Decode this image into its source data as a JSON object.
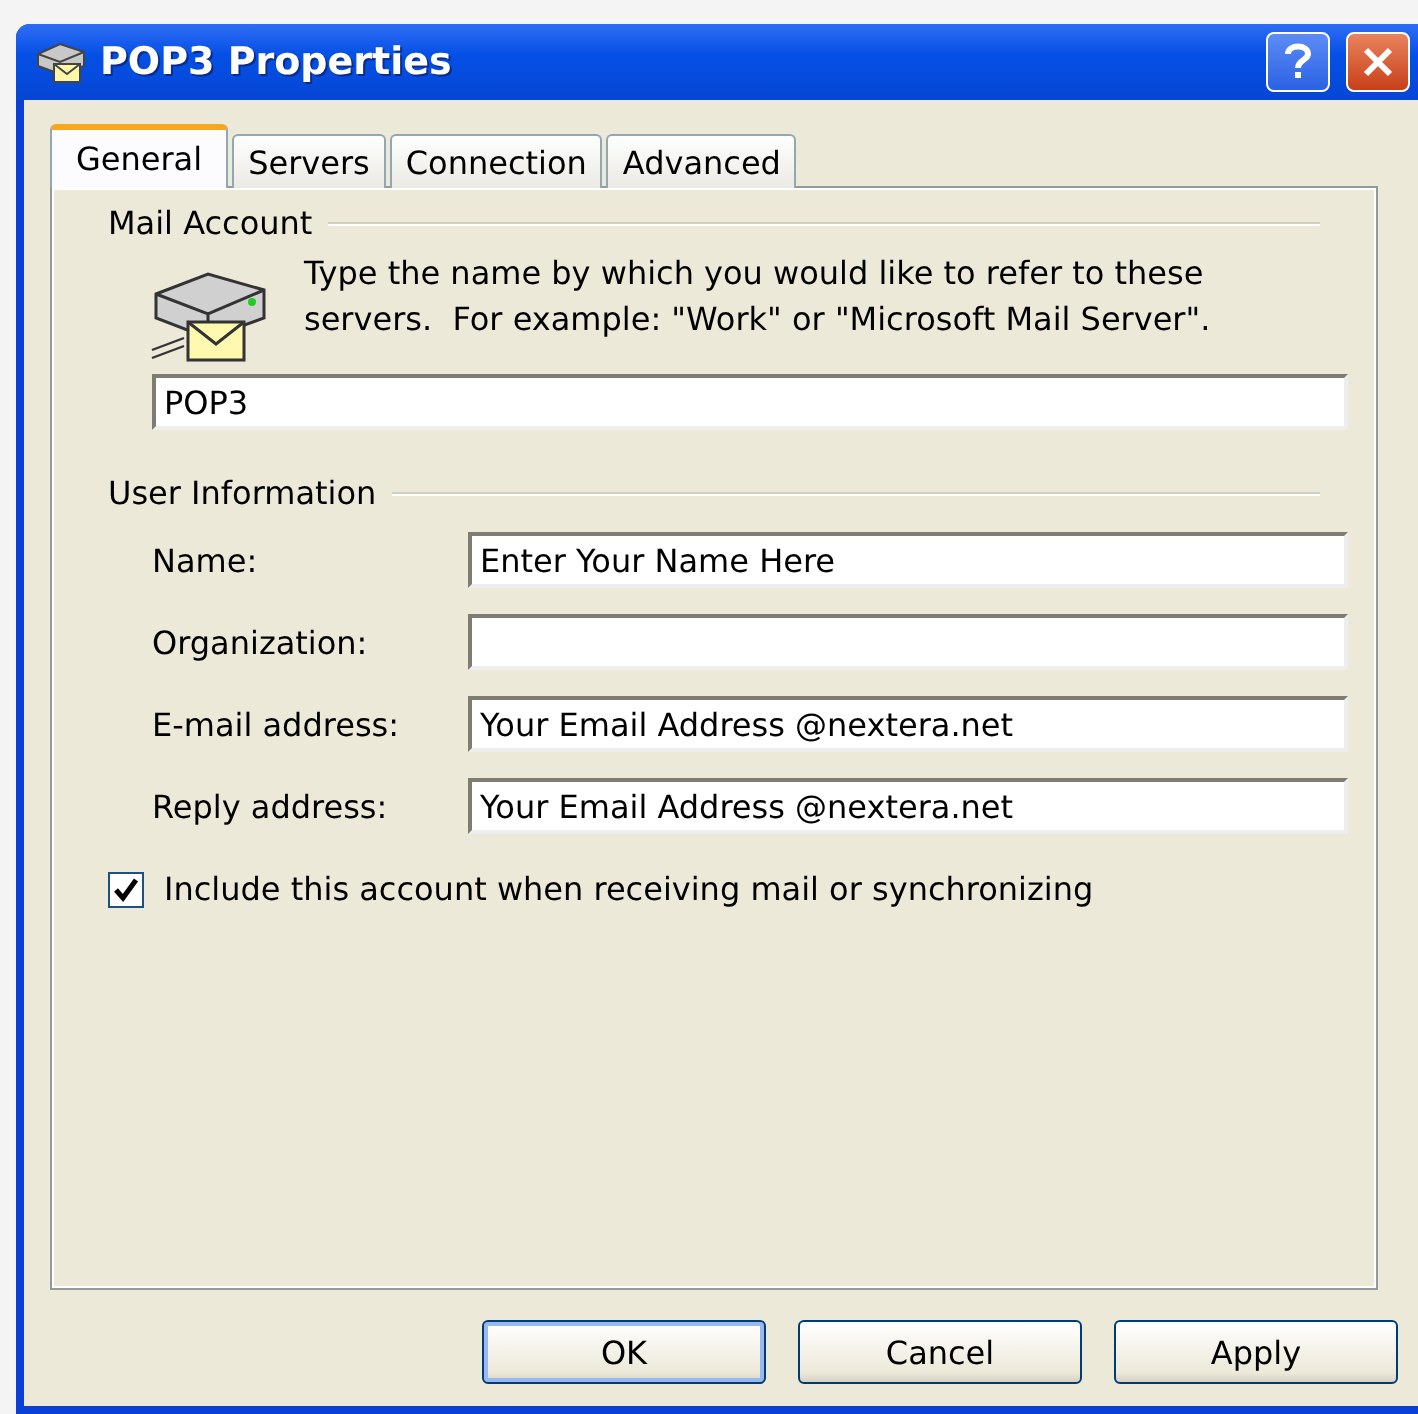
{
  "window": {
    "title": "POP3 Properties"
  },
  "tabs": [
    {
      "label": "General",
      "selected": true
    },
    {
      "label": "Servers",
      "selected": false
    },
    {
      "label": "Connection",
      "selected": false
    },
    {
      "label": "Advanced",
      "selected": false
    }
  ],
  "mail_account": {
    "heading": "Mail Account",
    "description": "Type the name by which you would like to refer to these servers.  For example: \"Work\" or \"Microsoft Mail Server\".",
    "value": "POP3"
  },
  "user_information": {
    "heading": "User Information",
    "fields": [
      {
        "label": "Name:",
        "value": "Enter Your Name Here"
      },
      {
        "label": "Organization:"
      },
      {
        "label": "E-mail address:",
        "value": "Your Email Address @nextera.net"
      },
      {
        "label": "Reply address:",
        "value": "Your Email Address @nextera.net"
      }
    ]
  },
  "include_account": {
    "label": "Include this account when receiving mail or synchronizing",
    "checked": true
  },
  "buttons": [
    {
      "label": "OK",
      "default": true
    },
    {
      "label": "Cancel",
      "default": false
    },
    {
      "label": "Apply",
      "default": false
    }
  ]
}
